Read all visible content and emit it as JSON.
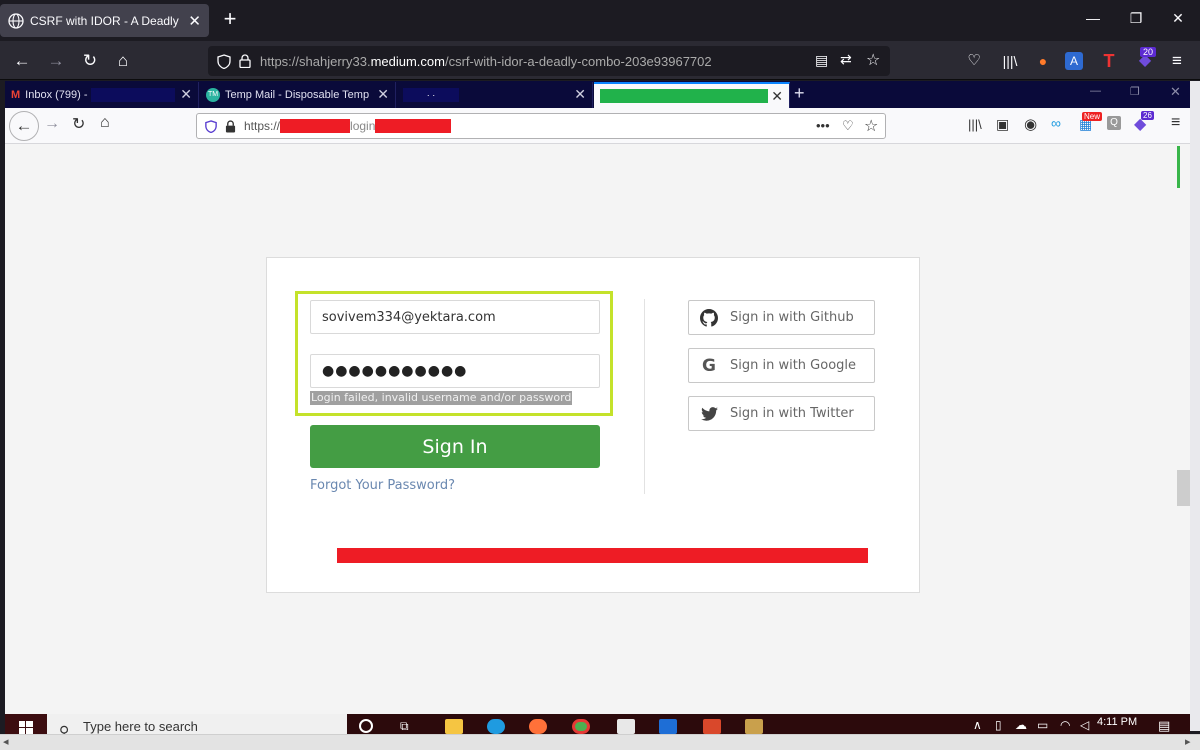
{
  "outer_browser": {
    "tab_title": "CSRF with IDOR - A Deadly Combo",
    "url_prefix": "https://shahjerry33.",
    "url_domain": "medium.com",
    "url_path": "/csrf-with-idor-a-deadly-combo-203e93967702",
    "extension_badge": "20"
  },
  "inner_browser": {
    "tabs": [
      {
        "label": "Inbox (799) -"
      },
      {
        "label": "Temp Mail - Disposable Tempo"
      },
      {
        "label": "· ·"
      },
      {
        "label": ""
      }
    ],
    "url_scheme": "https://",
    "url_mid": "login",
    "new_badge": "New",
    "extension_badge": "26"
  },
  "login": {
    "email_value": "sovivem334@yektara.com",
    "password_mask": "●●●●●●●●●●●",
    "error_message": "Login failed, invalid username and/or password",
    "signin_label": "Sign In",
    "forgot_label": "Forgot Your Password?",
    "social": [
      {
        "label": "Sign in with Github",
        "icon": "github-icon"
      },
      {
        "label": "Sign in with Google",
        "icon": "google-icon"
      },
      {
        "label": "Sign in with Twitter",
        "icon": "twitter-icon"
      }
    ]
  },
  "taskbar": {
    "search_placeholder": "Type here to search",
    "time": "4:11 PM"
  },
  "colors": {
    "signin_green": "#449d44",
    "highlight_box": "#c4e22a",
    "redaction_red": "#ee1c25",
    "redaction_green": "#21b24b",
    "link_blue": "#6a88b0"
  }
}
